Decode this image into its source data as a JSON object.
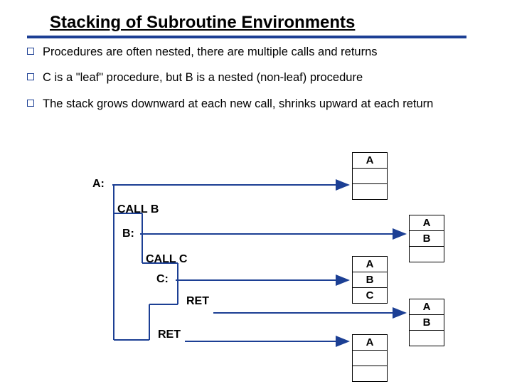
{
  "title": "Stacking of Subroutine Environments",
  "bullets": [
    "Procedures are often nested, there are multiple calls and returns",
    "C is a \"leaf\" procedure, but B is a nested (non-leaf) procedure",
    "The stack grows downward at each new call, shrinks upward at each return"
  ],
  "labels": {
    "A": "A:",
    "B": "B:",
    "C": "C:",
    "callB": "CALL B",
    "callC": "CALL C",
    "ret1": "RET",
    "ret2": "RET"
  },
  "stacks": {
    "s1": [
      "A",
      "",
      ""
    ],
    "s2": [
      "A",
      "B",
      ""
    ],
    "s3": [
      "A",
      "B",
      "C"
    ],
    "s4": [
      "A",
      "B",
      ""
    ],
    "s5": [
      "A",
      "",
      ""
    ]
  }
}
